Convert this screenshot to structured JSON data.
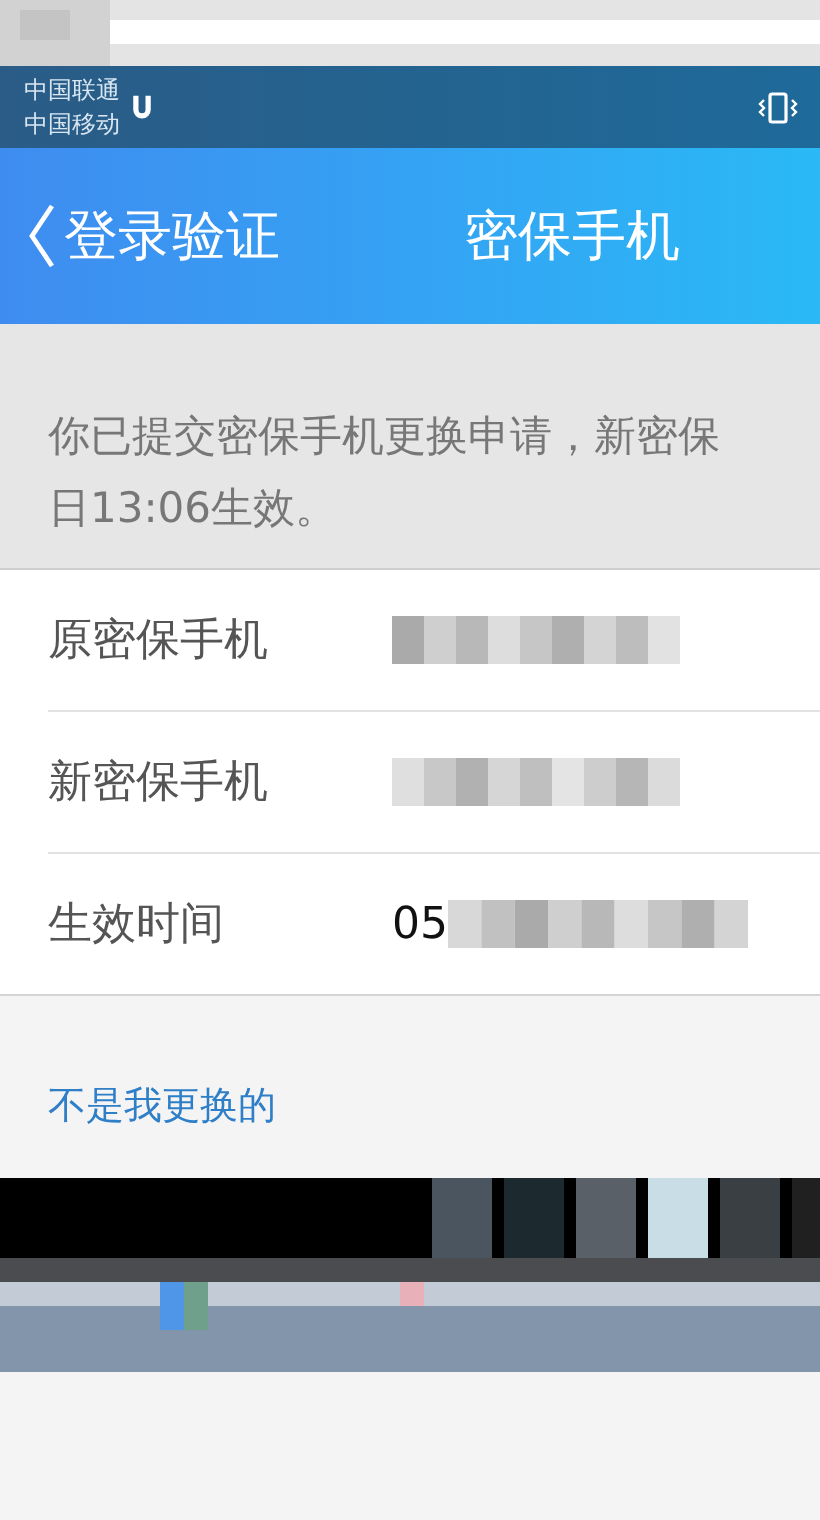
{
  "status_bar": {
    "carriers": [
      "中国联通",
      "中国移动"
    ]
  },
  "nav_bar": {
    "back_label": "登录验证",
    "title": "密保手机"
  },
  "notice": {
    "lines": [
      "你已提交密保手机更换申请，新密保",
      "日13:06生效。"
    ]
  },
  "rows": [
    {
      "label": "原密保手机"
    },
    {
      "label": "新密保手机"
    },
    {
      "label": "生效时间",
      "value": "05"
    }
  ],
  "link": "不是我更换的"
}
